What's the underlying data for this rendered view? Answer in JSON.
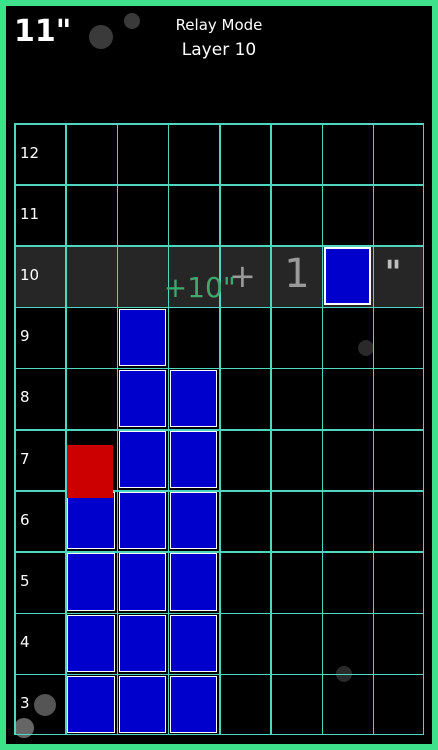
{
  "header": {
    "timer": "11\"",
    "mode": "Relay Mode",
    "layer": "Layer 10"
  },
  "grid": {
    "columns": 8,
    "rows": [
      12,
      11,
      10,
      9,
      8,
      7,
      6,
      5,
      4,
      3
    ],
    "active_row": 10,
    "blocks": [
      {
        "row": 9,
        "col": 2,
        "color": "blue"
      },
      {
        "row": 8,
        "col": 2,
        "color": "blue"
      },
      {
        "row": 8,
        "col": 3,
        "color": "blue"
      },
      {
        "row": 7,
        "col": 1,
        "color": "red"
      },
      {
        "row": 7,
        "col": 2,
        "color": "blue"
      },
      {
        "row": 7,
        "col": 3,
        "color": "blue"
      },
      {
        "row": 6,
        "col": 1,
        "color": "blue"
      },
      {
        "row": 6,
        "col": 2,
        "color": "blue"
      },
      {
        "row": 6,
        "col": 3,
        "color": "blue"
      },
      {
        "row": 5,
        "col": 1,
        "color": "blue"
      },
      {
        "row": 5,
        "col": 2,
        "color": "blue"
      },
      {
        "row": 5,
        "col": 3,
        "color": "blue"
      },
      {
        "row": 4,
        "col": 1,
        "color": "blue"
      },
      {
        "row": 4,
        "col": 2,
        "color": "blue"
      },
      {
        "row": 4,
        "col": 3,
        "color": "blue"
      },
      {
        "row": 3,
        "col": 1,
        "color": "blue"
      },
      {
        "row": 3,
        "col": 2,
        "color": "blue"
      },
      {
        "row": 3,
        "col": 3,
        "color": "blue"
      }
    ]
  },
  "active_overlay": {
    "bonus_text": "+10\"",
    "plus_text": "+",
    "count_text": "1",
    "quote_text": "\"",
    "target_col": 6
  },
  "colors": {
    "frame": "#3ee08c",
    "grid_lines": "#4fd6c0",
    "block_blue": "#0000cc",
    "block_red": "#cc0000",
    "bonus_green": "#3ea86e"
  }
}
